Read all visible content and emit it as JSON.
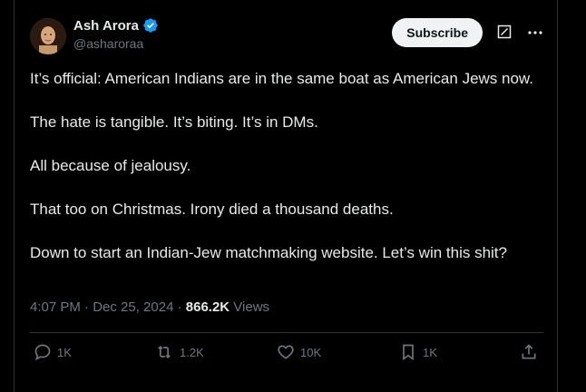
{
  "author": {
    "name": "Ash Arora",
    "handle": "@asharoraa",
    "verified": true
  },
  "header": {
    "subscribe_label": "Subscribe",
    "icons": [
      "grok-icon",
      "more-icon"
    ]
  },
  "tweet": {
    "paragraphs": [
      "It’s official: American Indians are in the same boat as American Jews now.",
      "The hate is tangible. It’s biting. It’s in DMs.",
      "All because of jealousy.",
      "That too on Christmas. Irony died a thousand deaths.",
      "Down to start an Indian-Jew matchmaking website. Let’s win this shit?"
    ]
  },
  "meta": {
    "time_date": "4:07 PM · Dec 25, 2024 · ",
    "views_count": "866.2K",
    "views_label": " Views"
  },
  "actions": {
    "replies": "1K",
    "reposts": "1.2K",
    "likes": "10K",
    "bookmarks": "1K"
  },
  "colors": {
    "background": "#000000",
    "text": "#e7e9ea",
    "muted": "#71767b",
    "verified": "#1d9bf0",
    "border": "#2f3336"
  }
}
